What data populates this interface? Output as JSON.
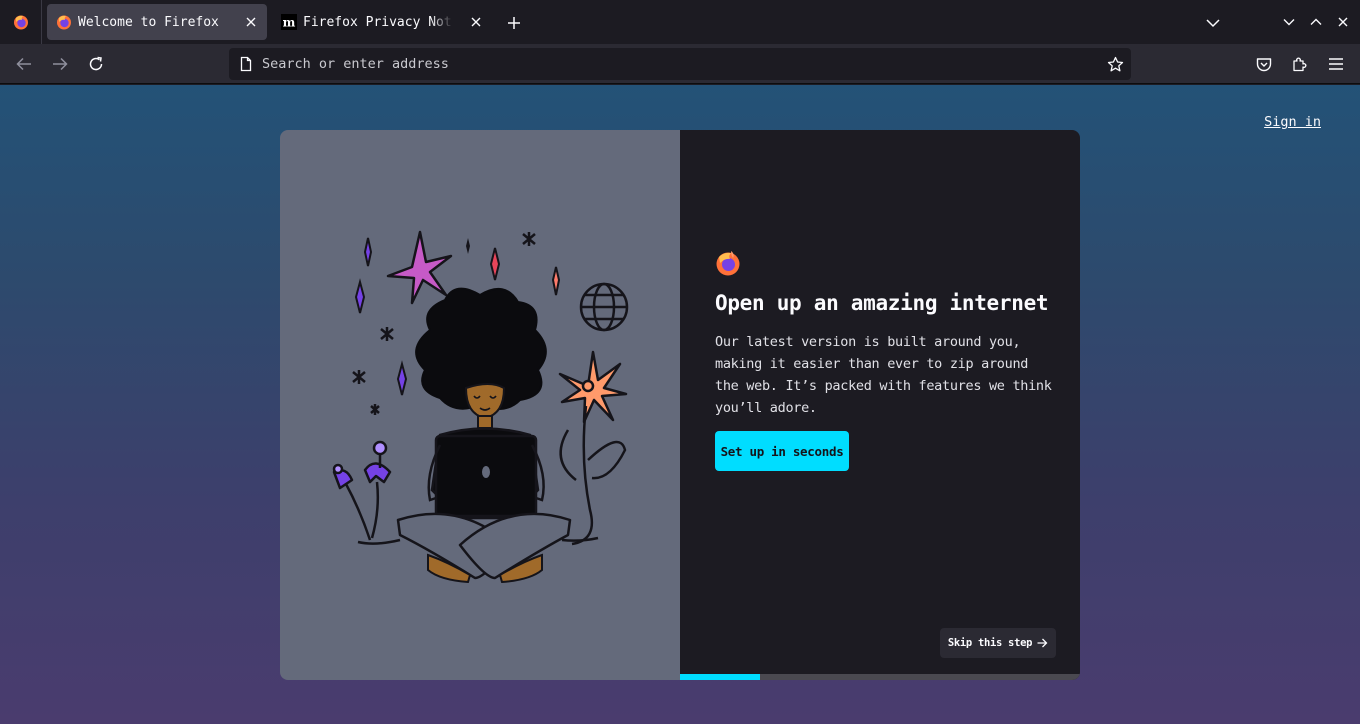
{
  "tabs": [
    {
      "title": "Welcome to Firefox",
      "icon": "firefox-icon",
      "active": true
    },
    {
      "title": "Firefox Privacy Notice — Mozilla",
      "icon": "mozilla-icon",
      "active": false
    }
  ],
  "toolbar": {
    "url_placeholder": "Search or enter address",
    "back_icon": "back-arrow-icon",
    "forward_icon": "forward-arrow-icon",
    "reload_icon": "reload-icon"
  },
  "page": {
    "signin_label": "Sign in",
    "headline": "Open up an amazing internet",
    "body": "Our latest version is built around you, making it easier than ever to zip around the web. It’s packed with features we think you’ll adore.",
    "primary_button": "Set up in seconds",
    "skip_button": "Skip this step",
    "progress": 0.2
  },
  "colors": {
    "accent": "#00ddff",
    "illustration_bg": "#646a7b",
    "card_bg": "#1c1b22"
  }
}
